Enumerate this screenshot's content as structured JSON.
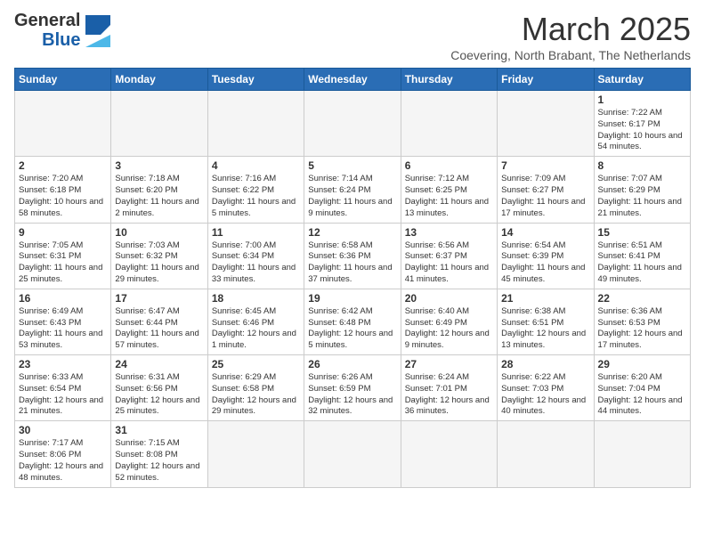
{
  "header": {
    "logo_general": "General",
    "logo_blue": "Blue",
    "month_title": "March 2025",
    "location": "Coevering, North Brabant, The Netherlands"
  },
  "weekdays": [
    "Sunday",
    "Monday",
    "Tuesday",
    "Wednesday",
    "Thursday",
    "Friday",
    "Saturday"
  ],
  "weeks": [
    [
      {
        "day": "",
        "info": ""
      },
      {
        "day": "",
        "info": ""
      },
      {
        "day": "",
        "info": ""
      },
      {
        "day": "",
        "info": ""
      },
      {
        "day": "",
        "info": ""
      },
      {
        "day": "",
        "info": ""
      },
      {
        "day": "1",
        "info": "Sunrise: 7:22 AM\nSunset: 6:17 PM\nDaylight: 10 hours and 54 minutes."
      }
    ],
    [
      {
        "day": "2",
        "info": "Sunrise: 7:20 AM\nSunset: 6:18 PM\nDaylight: 10 hours and 58 minutes."
      },
      {
        "day": "3",
        "info": "Sunrise: 7:18 AM\nSunset: 6:20 PM\nDaylight: 11 hours and 2 minutes."
      },
      {
        "day": "4",
        "info": "Sunrise: 7:16 AM\nSunset: 6:22 PM\nDaylight: 11 hours and 5 minutes."
      },
      {
        "day": "5",
        "info": "Sunrise: 7:14 AM\nSunset: 6:24 PM\nDaylight: 11 hours and 9 minutes."
      },
      {
        "day": "6",
        "info": "Sunrise: 7:12 AM\nSunset: 6:25 PM\nDaylight: 11 hours and 13 minutes."
      },
      {
        "day": "7",
        "info": "Sunrise: 7:09 AM\nSunset: 6:27 PM\nDaylight: 11 hours and 17 minutes."
      },
      {
        "day": "8",
        "info": "Sunrise: 7:07 AM\nSunset: 6:29 PM\nDaylight: 11 hours and 21 minutes."
      }
    ],
    [
      {
        "day": "9",
        "info": "Sunrise: 7:05 AM\nSunset: 6:31 PM\nDaylight: 11 hours and 25 minutes."
      },
      {
        "day": "10",
        "info": "Sunrise: 7:03 AM\nSunset: 6:32 PM\nDaylight: 11 hours and 29 minutes."
      },
      {
        "day": "11",
        "info": "Sunrise: 7:00 AM\nSunset: 6:34 PM\nDaylight: 11 hours and 33 minutes."
      },
      {
        "day": "12",
        "info": "Sunrise: 6:58 AM\nSunset: 6:36 PM\nDaylight: 11 hours and 37 minutes."
      },
      {
        "day": "13",
        "info": "Sunrise: 6:56 AM\nSunset: 6:37 PM\nDaylight: 11 hours and 41 minutes."
      },
      {
        "day": "14",
        "info": "Sunrise: 6:54 AM\nSunset: 6:39 PM\nDaylight: 11 hours and 45 minutes."
      },
      {
        "day": "15",
        "info": "Sunrise: 6:51 AM\nSunset: 6:41 PM\nDaylight: 11 hours and 49 minutes."
      }
    ],
    [
      {
        "day": "16",
        "info": "Sunrise: 6:49 AM\nSunset: 6:43 PM\nDaylight: 11 hours and 53 minutes."
      },
      {
        "day": "17",
        "info": "Sunrise: 6:47 AM\nSunset: 6:44 PM\nDaylight: 11 hours and 57 minutes."
      },
      {
        "day": "18",
        "info": "Sunrise: 6:45 AM\nSunset: 6:46 PM\nDaylight: 12 hours and 1 minute."
      },
      {
        "day": "19",
        "info": "Sunrise: 6:42 AM\nSunset: 6:48 PM\nDaylight: 12 hours and 5 minutes."
      },
      {
        "day": "20",
        "info": "Sunrise: 6:40 AM\nSunset: 6:49 PM\nDaylight: 12 hours and 9 minutes."
      },
      {
        "day": "21",
        "info": "Sunrise: 6:38 AM\nSunset: 6:51 PM\nDaylight: 12 hours and 13 minutes."
      },
      {
        "day": "22",
        "info": "Sunrise: 6:36 AM\nSunset: 6:53 PM\nDaylight: 12 hours and 17 minutes."
      }
    ],
    [
      {
        "day": "23",
        "info": "Sunrise: 6:33 AM\nSunset: 6:54 PM\nDaylight: 12 hours and 21 minutes."
      },
      {
        "day": "24",
        "info": "Sunrise: 6:31 AM\nSunset: 6:56 PM\nDaylight: 12 hours and 25 minutes."
      },
      {
        "day": "25",
        "info": "Sunrise: 6:29 AM\nSunset: 6:58 PM\nDaylight: 12 hours and 29 minutes."
      },
      {
        "day": "26",
        "info": "Sunrise: 6:26 AM\nSunset: 6:59 PM\nDaylight: 12 hours and 32 minutes."
      },
      {
        "day": "27",
        "info": "Sunrise: 6:24 AM\nSunset: 7:01 PM\nDaylight: 12 hours and 36 minutes."
      },
      {
        "day": "28",
        "info": "Sunrise: 6:22 AM\nSunset: 7:03 PM\nDaylight: 12 hours and 40 minutes."
      },
      {
        "day": "29",
        "info": "Sunrise: 6:20 AM\nSunset: 7:04 PM\nDaylight: 12 hours and 44 minutes."
      }
    ],
    [
      {
        "day": "30",
        "info": "Sunrise: 7:17 AM\nSunset: 8:06 PM\nDaylight: 12 hours and 48 minutes."
      },
      {
        "day": "31",
        "info": "Sunrise: 7:15 AM\nSunset: 8:08 PM\nDaylight: 12 hours and 52 minutes."
      },
      {
        "day": "",
        "info": ""
      },
      {
        "day": "",
        "info": ""
      },
      {
        "day": "",
        "info": ""
      },
      {
        "day": "",
        "info": ""
      },
      {
        "day": "",
        "info": ""
      }
    ]
  ]
}
